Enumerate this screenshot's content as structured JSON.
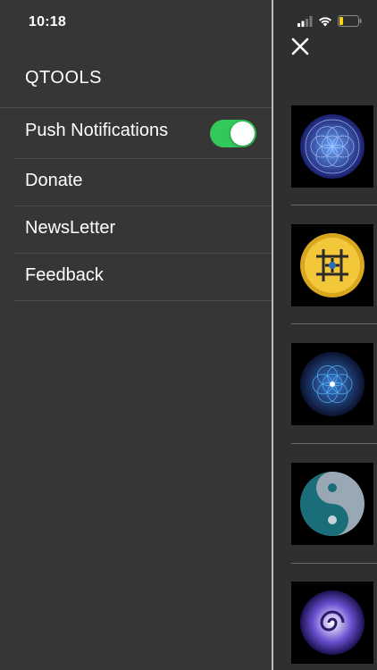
{
  "status_bar": {
    "time": "10:18"
  },
  "drawer": {
    "title": "QTOOLS",
    "items": [
      {
        "label": "Push Notifications",
        "toggle_on": true
      },
      {
        "label": "Donate"
      },
      {
        "label": "NewsLetter"
      },
      {
        "label": "Feedback"
      }
    ]
  },
  "icons": {
    "close": "close-icon",
    "signal": "cellular-signal-icon",
    "wifi": "wifi-icon",
    "battery": "battery-icon"
  },
  "colors": {
    "toggle_on": "#34c759",
    "battery_low": "#f7d21a"
  }
}
